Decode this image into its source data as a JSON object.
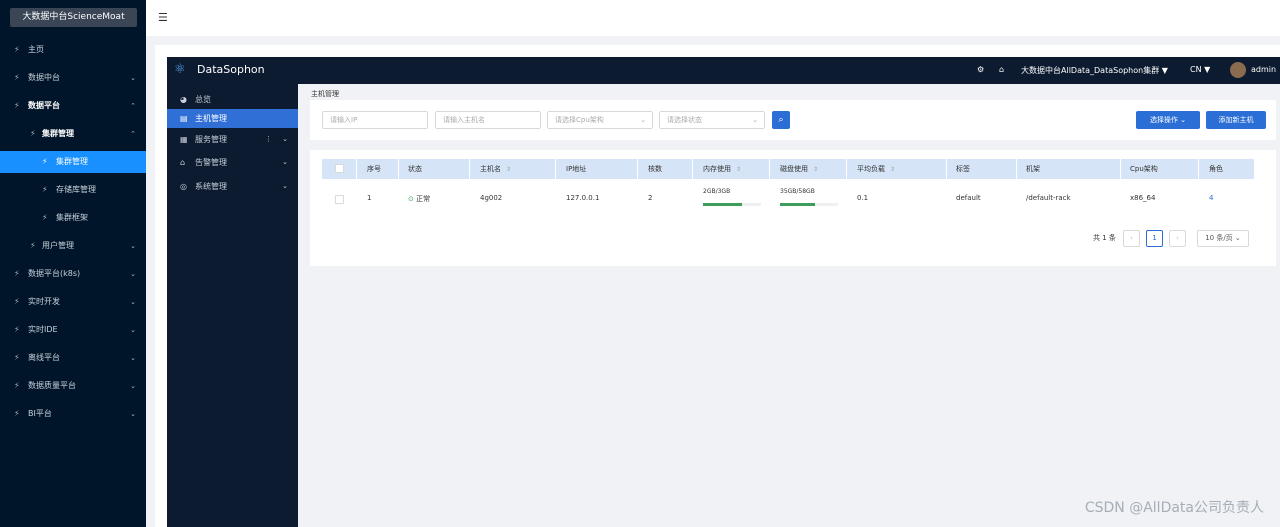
{
  "outer_sidebar": {
    "brand": "大数据中台ScienceMoat",
    "items": [
      {
        "label": "主页"
      },
      {
        "label": "数据中台"
      },
      {
        "label": "数据平台"
      },
      {
        "label": "集群管理"
      },
      {
        "label": "集群管理"
      },
      {
        "label": "存储库管理"
      },
      {
        "label": "集群框架"
      },
      {
        "label": "用户管理"
      },
      {
        "label": "数据平台(k8s)"
      },
      {
        "label": "实时开发"
      },
      {
        "label": "实时IDE"
      },
      {
        "label": "离线平台"
      },
      {
        "label": "数据质量平台"
      },
      {
        "label": "BI平台"
      }
    ]
  },
  "ds_header": {
    "title": "DataSophon",
    "cluster": "大数据中台AllData_DataSophon集群",
    "lang": "CN",
    "user": "admin"
  },
  "ds_sidebar": {
    "items": [
      {
        "label": "总览"
      },
      {
        "label": "主机管理"
      },
      {
        "label": "服务管理"
      },
      {
        "label": "告警管理"
      },
      {
        "label": "系统管理"
      }
    ]
  },
  "breadcrumb": "主机管理",
  "filters": {
    "ip_placeholder": "请输入IP",
    "host_placeholder": "请输入主机名",
    "cpu_placeholder": "请选择Cpu架构",
    "status_placeholder": "请选择状态",
    "select_action": "选择操作",
    "add_host": "添加新主机"
  },
  "table": {
    "headers": [
      "序号",
      "状态",
      "主机名",
      "IP地址",
      "核数",
      "内存使用",
      "磁盘使用",
      "平均负载",
      "标签",
      "机架",
      "Cpu架构",
      "角色"
    ],
    "row": {
      "index": "1",
      "status": "正常",
      "hostname": "4g002",
      "ip": "127.0.0.1",
      "cores": "2",
      "memory": "2GB/3GB",
      "memory_pct": 0.67,
      "disk": "35GB/58GB",
      "disk_pct": 0.6,
      "load": "0.1",
      "label": "default",
      "rack": "/default-rack",
      "cpu_arch": "x86_64",
      "roles": "4"
    }
  },
  "pagination": {
    "total": "共 1 条",
    "page": "1",
    "page_size": "10 条/页"
  },
  "watermark": "CSDN @AllData公司负责人"
}
